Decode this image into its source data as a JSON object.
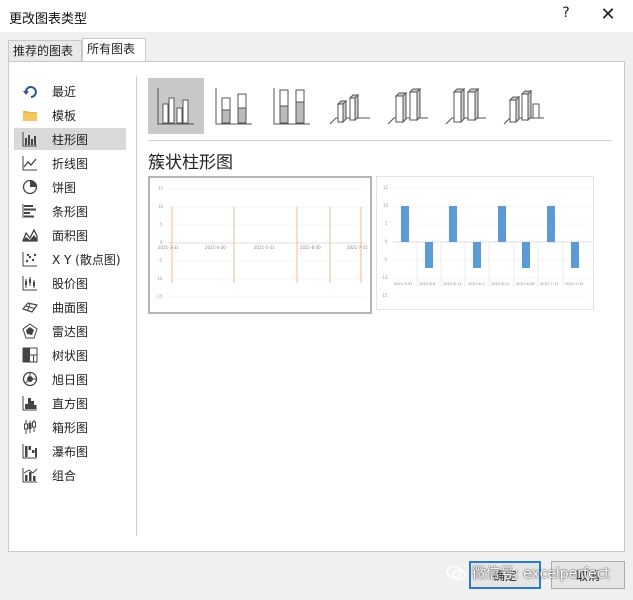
{
  "dialog": {
    "title": "更改图表类型",
    "help": "?",
    "close": "✕"
  },
  "tabs": [
    "推荐的图表",
    "所有图表"
  ],
  "sidebar": {
    "items": [
      {
        "label": "最近",
        "icon": "recent-icon"
      },
      {
        "label": "模板",
        "icon": "folder-icon"
      },
      {
        "label": "柱形图",
        "icon": "column-chart-icon"
      },
      {
        "label": "折线图",
        "icon": "line-chart-icon"
      },
      {
        "label": "饼图",
        "icon": "pie-chart-icon"
      },
      {
        "label": "条形图",
        "icon": "bar-chart-icon"
      },
      {
        "label": "面积图",
        "icon": "area-chart-icon"
      },
      {
        "label": "X Y (散点图)",
        "icon": "scatter-chart-icon"
      },
      {
        "label": "股价图",
        "icon": "stock-chart-icon"
      },
      {
        "label": "曲面图",
        "icon": "surface-chart-icon"
      },
      {
        "label": "雷达图",
        "icon": "radar-chart-icon"
      },
      {
        "label": "树状图",
        "icon": "treemap-chart-icon"
      },
      {
        "label": "旭日图",
        "icon": "sunburst-chart-icon"
      },
      {
        "label": "直方图",
        "icon": "histogram-chart-icon"
      },
      {
        "label": "箱形图",
        "icon": "box-whisker-chart-icon"
      },
      {
        "label": "瀑布图",
        "icon": "waterfall-chart-icon"
      },
      {
        "label": "组合",
        "icon": "combo-chart-icon"
      }
    ],
    "selected": "柱形图"
  },
  "subtypes": {
    "items": [
      "clustered-column-icon",
      "stacked-column-icon",
      "100-stacked-column-icon",
      "3d-clustered-column-icon",
      "3d-stacked-column-icon",
      "3d-100-stacked-column-icon",
      "3d-column-icon"
    ],
    "selected": "clustered-column-icon"
  },
  "section_title": "簇状柱形图",
  "preview1": {
    "y_ticks": [
      "15",
      "10",
      "5",
      "0",
      "-5",
      "-10",
      "-15"
    ],
    "x_labels": [
      "2021-3-31",
      "2021-4-30",
      "2021-5-31",
      "2021-6-30",
      "2021-7-31"
    ]
  },
  "preview2": {
    "y_ticks": [
      "15",
      "10",
      "5",
      "0",
      "-5",
      "-10",
      "-15"
    ],
    "x_labels": [
      "2021-5-31",
      "2021-6-6",
      "2021-6-11",
      "2021-6-1",
      "2021-6-21",
      "2021-6-28",
      "2021-7-11",
      "2021-7-31"
    ]
  },
  "buttons": {
    "ok": "确定",
    "cancel": "取消"
  },
  "watermark": "微信号: excelperfect",
  "colors": {
    "bar_blue": "#5b9bd5",
    "line_orange": "#f4b183",
    "accent": "#2a7ad5"
  }
}
